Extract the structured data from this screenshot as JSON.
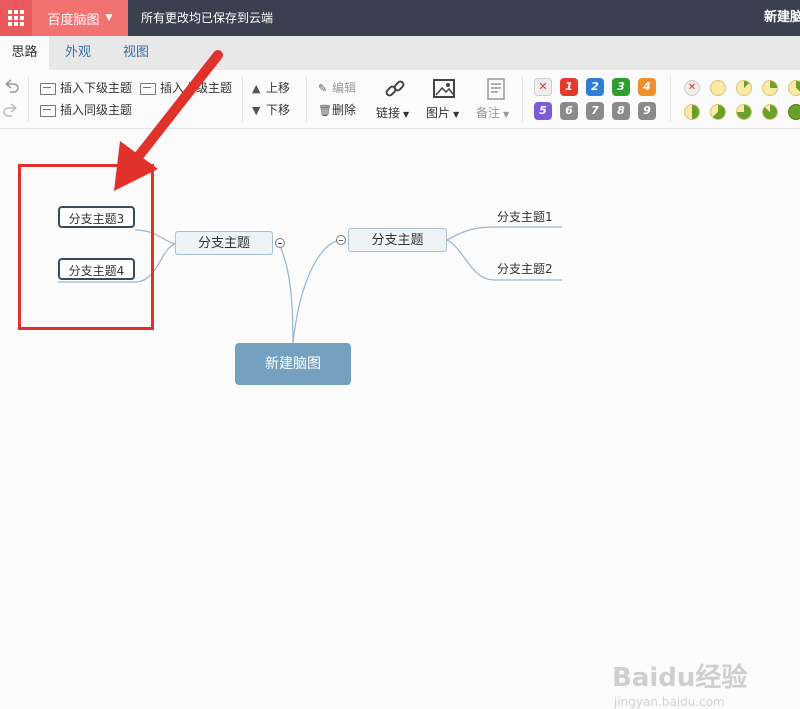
{
  "topbar": {
    "app_name": "百度脑图",
    "save_status": "所有更改均已保存到云端",
    "doc_title": "新建脑图"
  },
  "menu_tabs": [
    {
      "label": "思路",
      "active": true
    },
    {
      "label": "外观",
      "active": false
    },
    {
      "label": "视图",
      "active": false
    }
  ],
  "toolbar": {
    "insert_child": "插入下级主题",
    "insert_parent": "插入上级主题",
    "insert_sibling": "插入同级主题",
    "move_up": "上移",
    "move_down": "下移",
    "edit": "编辑",
    "delete": "删除",
    "link": "链接",
    "image": "图片",
    "note": "备注",
    "priority_badges": [
      "1",
      "2",
      "3",
      "4",
      "5",
      "6",
      "7",
      "8",
      "9"
    ],
    "priority_colors": [
      "#e23a2e",
      "#2d7fd6",
      "#2f9d2f",
      "#f0902c",
      "#7b5bd8",
      "#8a8a8a",
      "#8a8a8a",
      "#8a8a8a",
      "#8a8a8a"
    ],
    "progress_levels": [
      "clear",
      "0%",
      "12.5%",
      "25%",
      "37.5%",
      "50%",
      "62.5%",
      "75%",
      "87.5%",
      "100%"
    ]
  },
  "mindmap": {
    "root": "新建脑图",
    "left_branch": "分支主题",
    "right_branch": "分支主题",
    "left_leaf_1": "分支主题3",
    "left_leaf_2": "分支主题4",
    "right_leaf_1": "分支主题1",
    "right_leaf_2": "分支主题2"
  },
  "colors": {
    "highlight": "#e0322b",
    "root_fill": "#73a1bf",
    "topbar": "#3a4050",
    "app_tab": "#f27272"
  },
  "watermark": {
    "brand": "Baidu经验",
    "url": "jingyan.baidu.com"
  }
}
